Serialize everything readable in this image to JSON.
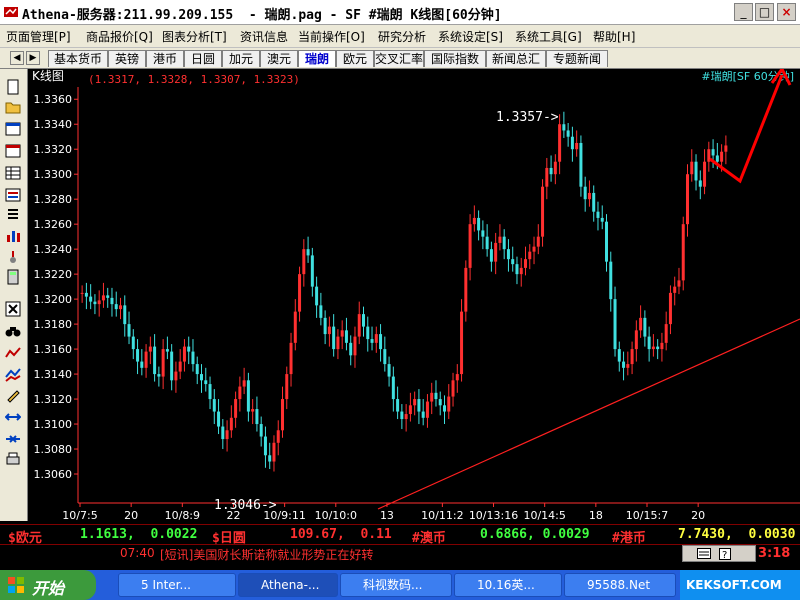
{
  "window": {
    "title": "Athena-服务器:211.99.209.155  - 瑞朗.pag - SF #瑞朗 K线图[60分钟]",
    "minimize": "_",
    "maximize": "□",
    "close": "×"
  },
  "menu": [
    "页面管理[P]",
    "商品报价[Q]",
    "图表分析[T]",
    "资讯信息",
    "当前操作[O]",
    "研究分析",
    "系统设定[S]",
    "系统工具[G]",
    "帮助[H]"
  ],
  "tabs": {
    "items": [
      "基本货币",
      "英镑",
      "港币",
      "日圆",
      "加元",
      "澳元",
      "瑞朗",
      "欧元",
      "交叉汇率",
      "国际指数",
      "新闻总汇",
      "专题新闻"
    ],
    "active": "瑞朗"
  },
  "chart": {
    "header_label": "K线图",
    "ohlc_text": "(1.3317, 1.3328, 1.3307, 1.3323)",
    "symbol_text": "#瑞朗[SF 60分钟]",
    "high_annotation": "1.3357->",
    "low_annotation": "1.3046->",
    "colors": {
      "up": "#ff3030",
      "down": "#40e0e0",
      "axis": "#ff3030",
      "text": "#ffffff",
      "trendline": "#ff2020",
      "arrow": "#ff0000"
    }
  },
  "chart_data": {
    "type": "candlestick",
    "y_ticks": [
      "1.3360",
      "1.3340",
      "1.3320",
      "1.3300",
      "1.3280",
      "1.3260",
      "1.3240",
      "1.3220",
      "1.3200",
      "1.3180",
      "1.3160",
      "1.3140",
      "1.3120",
      "1.3100",
      "1.3080",
      "1.3060"
    ],
    "x_ticks": [
      "10/7:5",
      "20",
      "10/8:9",
      "22",
      "10/9:11",
      "10/10:0",
      "13",
      "10/11:2",
      "10/13:16",
      "10/14:5",
      "18",
      "10/15:7",
      "20"
    ],
    "ylim": [
      1.304,
      1.3365
    ],
    "closes": [
      1.3205,
      1.3202,
      1.3198,
      1.3196,
      1.3199,
      1.3203,
      1.3201,
      1.3196,
      1.3192,
      1.3195,
      1.318,
      1.317,
      1.316,
      1.315,
      1.3145,
      1.3158,
      1.3162,
      1.314,
      1.3138,
      1.316,
      1.3158,
      1.3135,
      1.3142,
      1.315,
      1.3162,
      1.3158,
      1.3148,
      1.314,
      1.3135,
      1.3132,
      1.312,
      1.311,
      1.3098,
      1.3088,
      1.3095,
      1.3105,
      1.312,
      1.313,
      1.3135,
      1.311,
      1.3112,
      1.31,
      1.309,
      1.3075,
      1.307,
      1.3085,
      1.3095,
      1.312,
      1.314,
      1.3165,
      1.319,
      1.322,
      1.324,
      1.3235,
      1.321,
      1.3195,
      1.3185,
      1.3172,
      1.3178,
      1.316,
      1.317,
      1.3175,
      1.3165,
      1.3155,
      1.317,
      1.3188,
      1.3178,
      1.3168,
      1.3165,
      1.3172,
      1.316,
      1.3148,
      1.3138,
      1.312,
      1.311,
      1.3104,
      1.3108,
      1.3115,
      1.312,
      1.311,
      1.3105,
      1.3118,
      1.3125,
      1.312,
      1.3115,
      1.311,
      1.3122,
      1.3135,
      1.314,
      1.319,
      1.3225,
      1.326,
      1.3265,
      1.3255,
      1.325,
      1.324,
      1.323,
      1.3245,
      1.325,
      1.324,
      1.3232,
      1.3228,
      1.322,
      1.3225,
      1.3232,
      1.3238,
      1.3242,
      1.325,
      1.329,
      1.3305,
      1.33,
      1.331,
      1.334,
      1.3335,
      1.333,
      1.332,
      1.3325,
      1.329,
      1.328,
      1.3285,
      1.327,
      1.3265,
      1.3262,
      1.323,
      1.32,
      1.316,
      1.315,
      1.3145,
      1.3148,
      1.316,
      1.3175,
      1.3185,
      1.317,
      1.316,
      1.3162,
      1.316,
      1.3165,
      1.318,
      1.3205,
      1.321,
      1.3215,
      1.326,
      1.33,
      1.331,
      1.3295,
      1.329,
      1.331,
      1.332,
      1.3315,
      1.331,
      1.3318,
      1.3323
    ]
  },
  "status_bar": {
    "eur_label": "$欧元",
    "eur_values": "1.1613,  0.0022",
    "jpy_label": "$日圆",
    "jpy_values": "109.67,  0.11",
    "aud_label": "#澳币",
    "aud_values": "0.6866, 0.0029",
    "hkd_label": "#港币",
    "hkd_values": "7.7430,  0.0030"
  },
  "news": {
    "time": "07:40",
    "headline": "[短讯]美国财长斯诺称就业形势正在好转",
    "clock_suffix": "3:18"
  },
  "taskbar": {
    "start_label": "开始",
    "tasks": [
      "5 Inter...",
      "Athena-...",
      "科视数码...",
      "10.16英...",
      "95588.Net"
    ],
    "active_index": 1,
    "tray_text": "KEKSOFT.COM"
  }
}
